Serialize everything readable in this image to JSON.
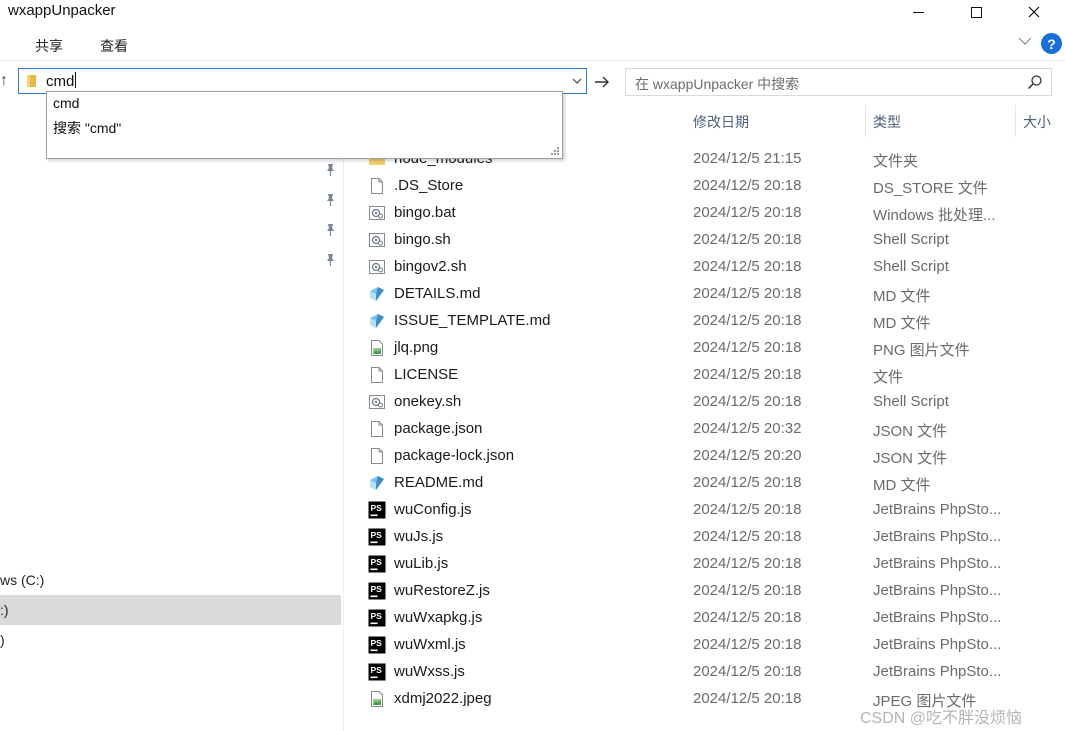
{
  "window": {
    "title": "wxappUnpacker",
    "minimize": "—",
    "maximize": "☐",
    "close": "✕"
  },
  "ribbon": {
    "tabs": [
      "共享",
      "查看"
    ],
    "help": "?"
  },
  "address": {
    "value": "cmd"
  },
  "search": {
    "placeholder": "在 wxappUnpacker 中搜索"
  },
  "autocomplete": {
    "items": [
      "cmd",
      "搜索 \"cmd\""
    ]
  },
  "nav": {
    "fragments": [
      "ws (C:)",
      ":)",
      ")"
    ]
  },
  "columns": {
    "date": "修改日期",
    "type": "类型",
    "size": "大小"
  },
  "files": [
    {
      "name": "node_modules",
      "date": "2024/12/5 21:15",
      "type": "文件夹",
      "icon": "folder"
    },
    {
      "name": ".DS_Store",
      "date": "2024/12/5 20:18",
      "type": "DS_STORE 文件",
      "icon": "blank"
    },
    {
      "name": "bingo.bat",
      "date": "2024/12/5 20:18",
      "type": "Windows 批处理...",
      "icon": "script"
    },
    {
      "name": "bingo.sh",
      "date": "2024/12/5 20:18",
      "type": "Shell Script",
      "icon": "script"
    },
    {
      "name": "bingov2.sh",
      "date": "2024/12/5 20:18",
      "type": "Shell Script",
      "icon": "script"
    },
    {
      "name": "DETAILS.md",
      "date": "2024/12/5 20:18",
      "type": "MD 文件",
      "icon": "markdown"
    },
    {
      "name": "ISSUE_TEMPLATE.md",
      "date": "2024/12/5 20:18",
      "type": "MD 文件",
      "icon": "markdown"
    },
    {
      "name": "jlq.png",
      "date": "2024/12/5 20:18",
      "type": "PNG 图片文件",
      "icon": "image"
    },
    {
      "name": "LICENSE",
      "date": "2024/12/5 20:18",
      "type": "文件",
      "icon": "blank"
    },
    {
      "name": "onekey.sh",
      "date": "2024/12/5 20:18",
      "type": "Shell Script",
      "icon": "script"
    },
    {
      "name": "package.json",
      "date": "2024/12/5 20:32",
      "type": "JSON 文件",
      "icon": "blank"
    },
    {
      "name": "package-lock.json",
      "date": "2024/12/5 20:20",
      "type": "JSON 文件",
      "icon": "blank"
    },
    {
      "name": "README.md",
      "date": "2024/12/5 20:18",
      "type": "MD 文件",
      "icon": "markdown"
    },
    {
      "name": "wuConfig.js",
      "date": "2024/12/5 20:18",
      "type": "JetBrains PhpSto...",
      "icon": "phpstorm"
    },
    {
      "name": "wuJs.js",
      "date": "2024/12/5 20:18",
      "type": "JetBrains PhpSto...",
      "icon": "phpstorm"
    },
    {
      "name": "wuLib.js",
      "date": "2024/12/5 20:18",
      "type": "JetBrains PhpSto...",
      "icon": "phpstorm"
    },
    {
      "name": "wuRestoreZ.js",
      "date": "2024/12/5 20:18",
      "type": "JetBrains PhpSto...",
      "icon": "phpstorm"
    },
    {
      "name": "wuWxapkg.js",
      "date": "2024/12/5 20:18",
      "type": "JetBrains PhpSto...",
      "icon": "phpstorm"
    },
    {
      "name": "wuWxml.js",
      "date": "2024/12/5 20:18",
      "type": "JetBrains PhpSto...",
      "icon": "phpstorm"
    },
    {
      "name": "wuWxss.js",
      "date": "2024/12/5 20:18",
      "type": "JetBrains PhpSto...",
      "icon": "phpstorm"
    },
    {
      "name": "xdmj2022.jpeg",
      "date": "2024/12/5 20:18",
      "type": "JPEG 图片文件",
      "icon": "image"
    }
  ],
  "watermark": "CSDN @吃不胖没烦恼",
  "colors": {
    "accent": "#2a7fd4",
    "help": "#1a6fd4",
    "selection": "#d9d9d9",
    "folder": "#e8b84a"
  }
}
